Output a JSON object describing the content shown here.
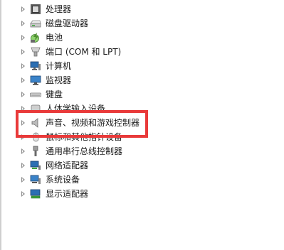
{
  "device_manager": {
    "categories": [
      {
        "label": "处理器",
        "icon": "processor-icon"
      },
      {
        "label": "磁盘驱动器",
        "icon": "disk-drive-icon"
      },
      {
        "label": "电池",
        "icon": "battery-icon"
      },
      {
        "label": "端口 (COM 和 LPT)",
        "icon": "port-icon"
      },
      {
        "label": "计算机",
        "icon": "computer-icon"
      },
      {
        "label": "监视器",
        "icon": "monitor-icon"
      },
      {
        "label": "键盘",
        "icon": "keyboard-icon"
      },
      {
        "label": "人体学输入设备",
        "icon": "hid-icon"
      },
      {
        "label": "声音、视频和游戏控制器",
        "icon": "speaker-icon"
      },
      {
        "label": "鼠标和其他指针设备",
        "icon": "mouse-icon"
      },
      {
        "label": "通用串行总线控制器",
        "icon": "usb-icon"
      },
      {
        "label": "网络适配器",
        "icon": "network-adapter-icon"
      },
      {
        "label": "系统设备",
        "icon": "system-device-icon"
      },
      {
        "label": "显示适配器",
        "icon": "display-adapter-icon"
      }
    ],
    "highlighted_item": "声音、视频和游戏控制器",
    "highlight_color": "#e93a3a"
  }
}
